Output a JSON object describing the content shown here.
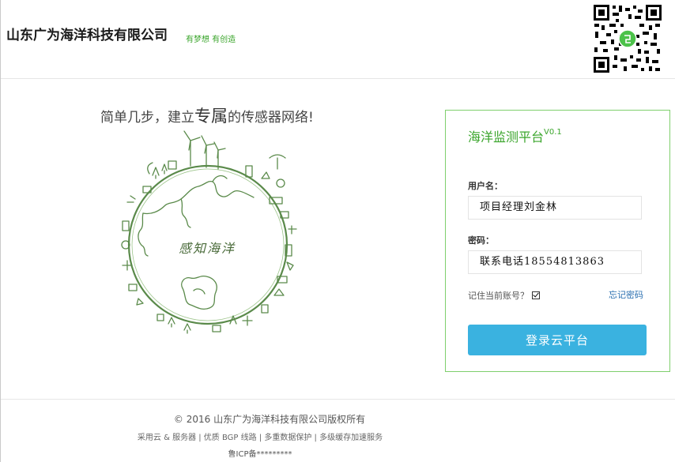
{
  "header": {
    "company_name": "山东广为海洋科技有限公司",
    "slogan": "有梦想 有创造"
  },
  "hero": {
    "tagline_pre": "简单几步，建立",
    "tagline_emph": "专属",
    "tagline_post": "的传感器网络!",
    "globe_text": "感知海洋"
  },
  "login": {
    "title": "海洋监测平台",
    "version": "V0.1",
    "username_label": "用户名：",
    "username_value": "项目经理刘金林",
    "password_label": "密码：",
    "password_value": "联系电话18554813863",
    "remember_label": "记住当前账号？",
    "forgot_label": "忘记密码",
    "submit_label": "登录云平台"
  },
  "footer": {
    "copyright": "© 2016 山东广为海洋科技有限公司版权所有",
    "services": "采用云 & 服务器 | 优质 BGP 线路 | 多重数据保护 | 多级缓存加速服务",
    "icp": "鲁ICP备*********"
  },
  "colors": {
    "accent_green": "#3aa52b",
    "button_blue": "#3ab2e0",
    "link_blue": "#2a6fb0",
    "panel_border": "#7fcf6d"
  }
}
